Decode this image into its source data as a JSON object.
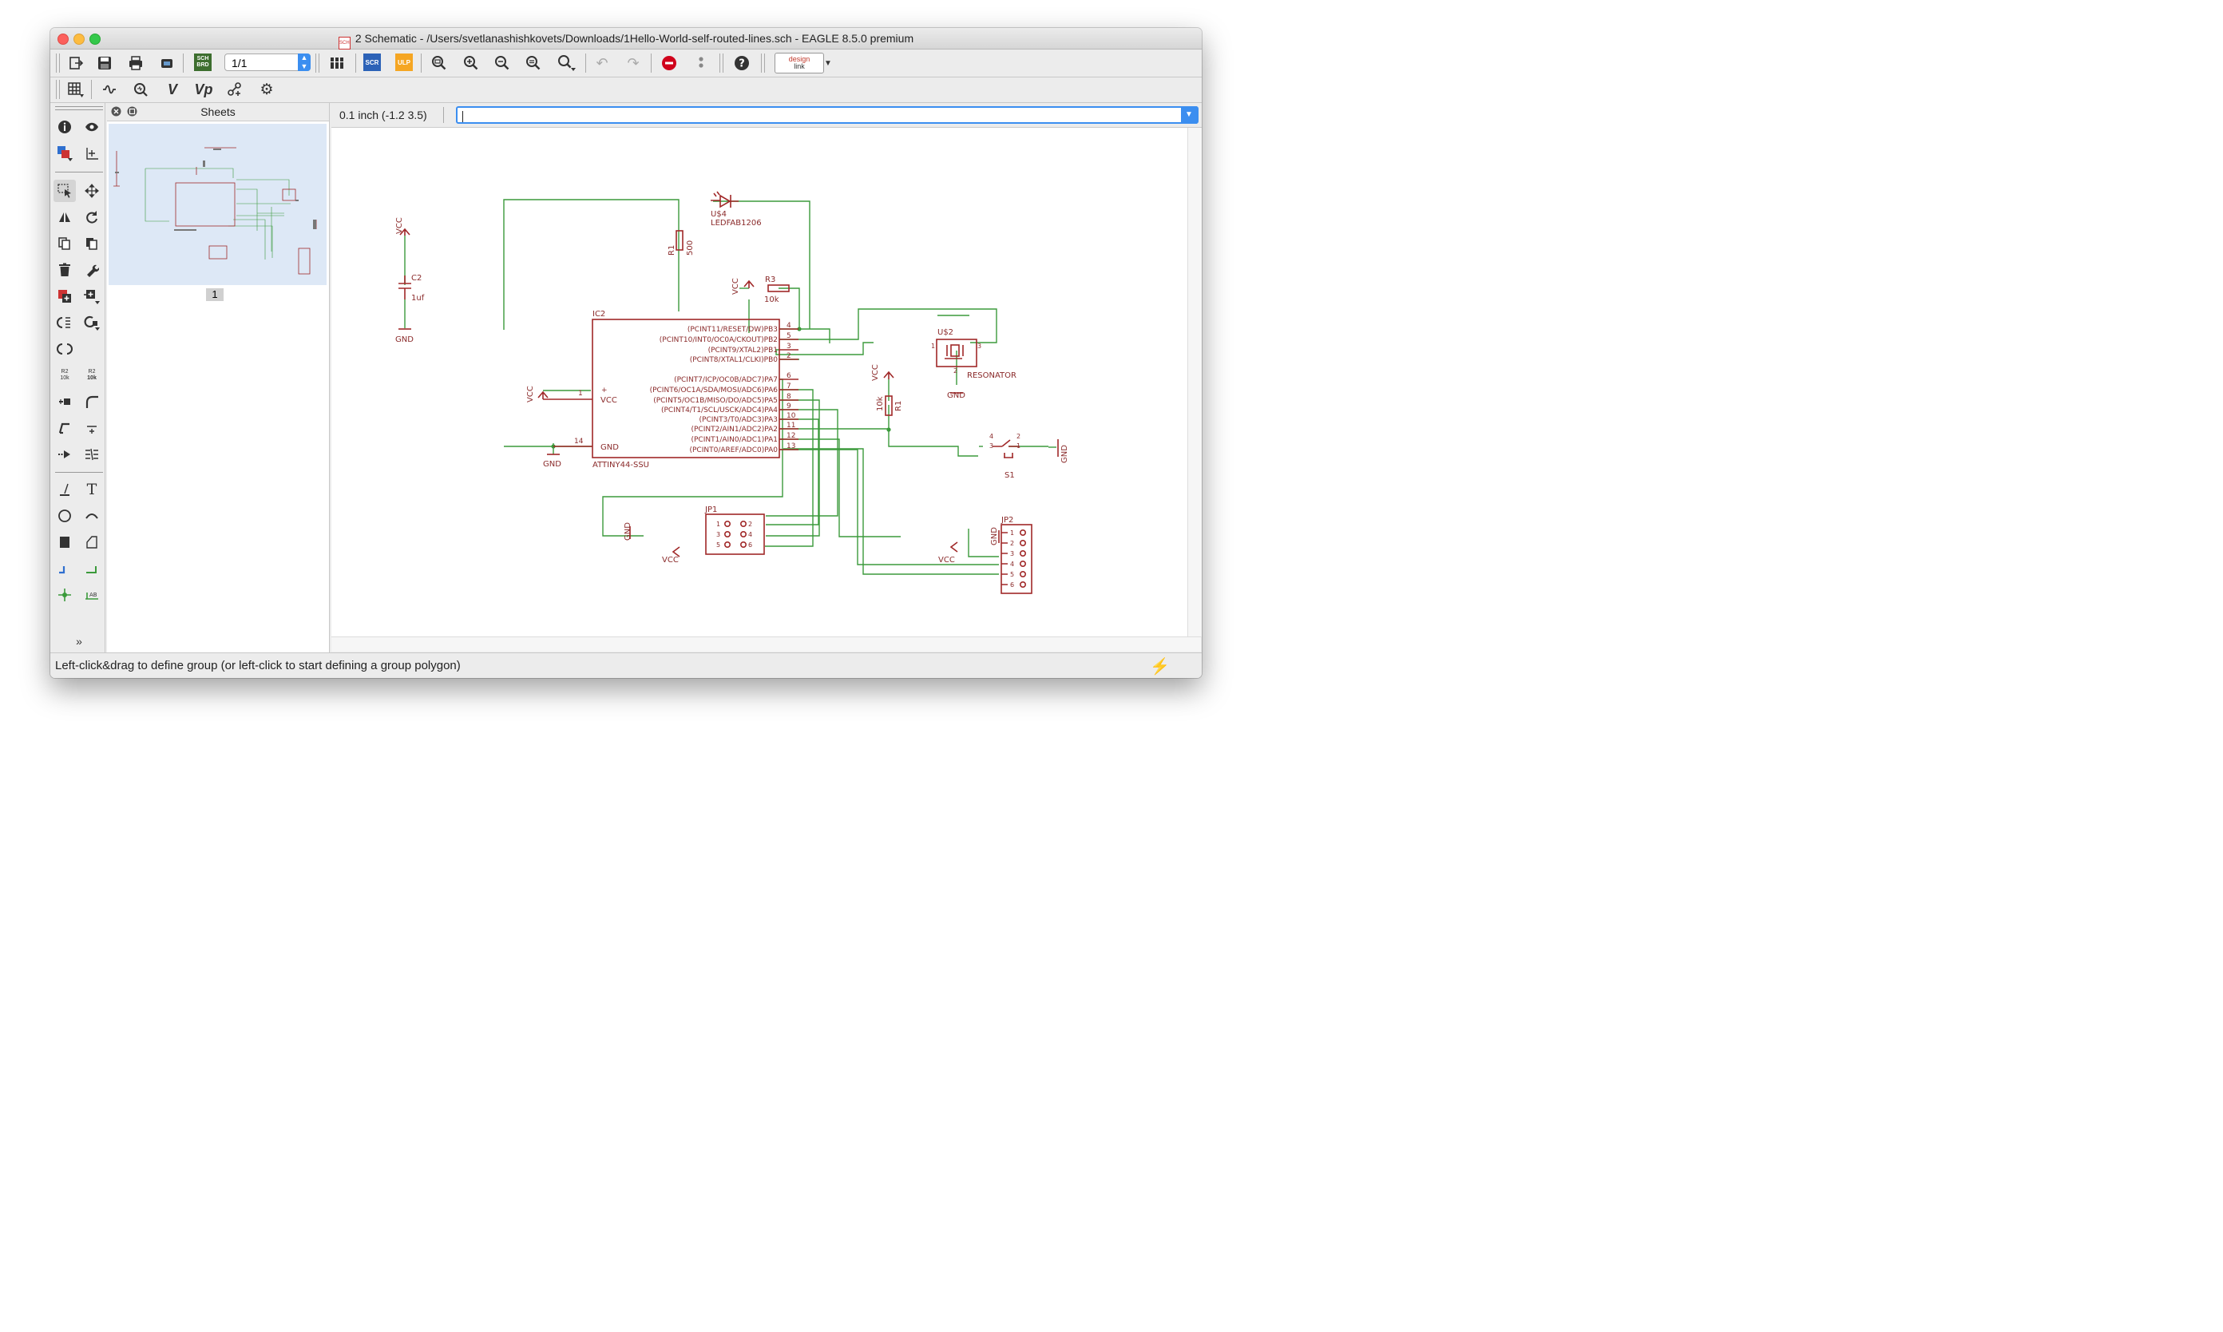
{
  "window": {
    "title": "2 Schematic - /Users/svetlanashishkovets/Downloads/1Hello-World-self-routed-lines.sch - EAGLE 8.5.0 premium",
    "doc_icon_text": "SCH"
  },
  "toolbar": {
    "sheet_value": "1/1",
    "scr_label": "SCR",
    "ulp_label": "ULP",
    "sch_brd_top": "SCH",
    "sch_brd_bottom": "BRD",
    "designlink_top": "design",
    "designlink_bottom": "link",
    "accent": "#3b8ef0"
  },
  "toolbar2": {
    "v_label": "V",
    "vp_label": "Vp"
  },
  "left_tools": {
    "text_tool": "T",
    "r2_label": "R2",
    "tenk_label": "10k",
    "ab_label": "AB"
  },
  "sheets_panel": {
    "title": "Sheets",
    "page_number": "1"
  },
  "command": {
    "grid_coords": "0.1 inch (-1.2 3.5)",
    "input_value": ""
  },
  "status": {
    "message": "Left-click&drag to define group (or left-click to start defining a group polygon)"
  },
  "schematic": {
    "colors": {
      "wire": "#3b9a3b",
      "part": "#a02828",
      "text": "#8a2a2a"
    },
    "vcc": "VCC",
    "gnd": "GND",
    "c2_name": "C2",
    "c2_value": "1uf",
    "r1_name": "R1",
    "r1_value": "10k",
    "r2_name": "R1",
    "r2_value": "500",
    "r3_name": "R3",
    "r3_value": "10k",
    "u4_name": "U$4",
    "u4_value": "LEDFAB1206",
    "u2_name": "U$2",
    "u2_value": "RESONATOR",
    "s1_name": "S1",
    "jp1_name": "JP1",
    "jp2_name": "JP2",
    "ic_name": "IC2",
    "ic_value": "ATTINY44-SSU",
    "ic_vcc": "VCC",
    "ic_gnd": "GND",
    "ic_pins_left": [
      {
        "num": "1",
        "label": "VCC"
      },
      {
        "num": "14",
        "label": "GND"
      }
    ],
    "ic_pins_right": [
      {
        "num": "4",
        "label": "(PCINT11/RESET/DW)PB3"
      },
      {
        "num": "5",
        "label": "(PCINT10/INT0/OC0A/CKOUT)PB2"
      },
      {
        "num": "3",
        "label": "(PCINT9/XTAL2)PB1"
      },
      {
        "num": "2",
        "label": "(PCINT8/XTAL1/CLKI)PB0"
      },
      {
        "num": "6",
        "label": "(PCINT7/ICP/OC0B/ADC7)PA7"
      },
      {
        "num": "7",
        "label": "(PCINT6/OC1A/SDA/MOSI/ADC6)PA6"
      },
      {
        "num": "8",
        "label": "(PCINT5/OC1B/MISO/DO/ADC5)PA5"
      },
      {
        "num": "9",
        "label": "(PCINT4/T1/SCL/USCK/ADC4)PA4"
      },
      {
        "num": "10",
        "label": "(PCINT3/T0/ADC3)PA3"
      },
      {
        "num": "11",
        "label": "(PCINT2/AIN1/ADC2)PA2"
      },
      {
        "num": "12",
        "label": "(PCINT1/AIN0/ADC1)PA1"
      },
      {
        "num": "13",
        "label": "(PCINT0/AREF/ADC0)PA0"
      }
    ],
    "jp1_pins": [
      "1",
      "2",
      "3",
      "4",
      "5",
      "6"
    ],
    "jp2_pins": [
      "1",
      "2",
      "3",
      "4",
      "5",
      "6"
    ],
    "res_pins": [
      "1",
      "2",
      "3"
    ],
    "s1_pins": [
      "4",
      "3",
      "2",
      "1"
    ]
  }
}
